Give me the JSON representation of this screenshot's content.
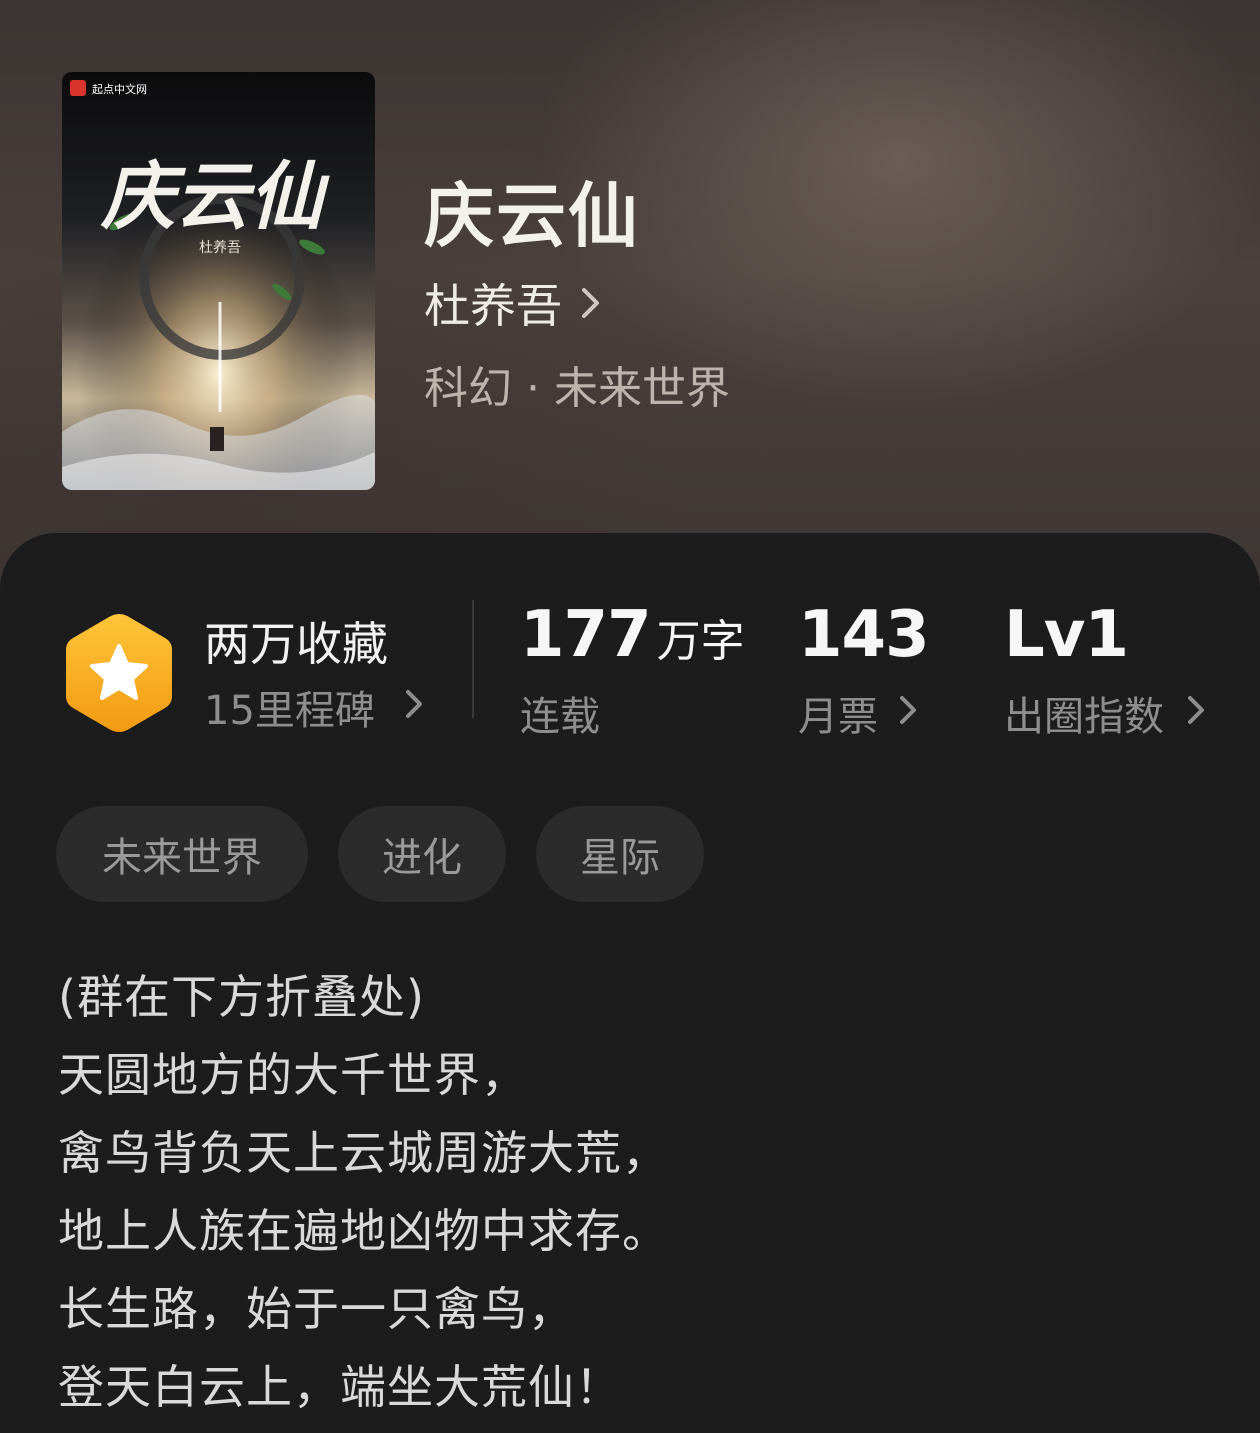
{
  "book": {
    "title": "庆云仙",
    "author": "杜养吾",
    "genre": "科幻 · 未来世界",
    "cover": {
      "publisher_logo_text": "起点中文网",
      "title_art": "庆云仙",
      "author_art": "杜养吾"
    }
  },
  "stats": {
    "favorites": {
      "main": "两万收藏",
      "sub": "15里程碑"
    },
    "word_count": {
      "value": "177",
      "unit": "万字",
      "label": "连载"
    },
    "monthly_tickets": {
      "value": "143",
      "label": "月票"
    },
    "popularity": {
      "value": "Lv1",
      "label": "出圈指数"
    }
  },
  "tags": [
    "未来世界",
    "进化",
    "星际"
  ],
  "description": [
    "(群在下方折叠处)",
    "天圆地方的大千世界，",
    "禽鸟背负天上云城周游大荒，",
    "地上人族在遍地凶物中求存。",
    "长生路，始于一只禽鸟，",
    "登天白云上，端坐大荒仙！"
  ],
  "colors": {
    "background": "#1c1c1c",
    "hero_top": "#3b3432",
    "badge_orange": "#f5a623",
    "tag_bg": "#2b2b2b",
    "muted_text": "#8e8e8e"
  },
  "icons": {
    "badge": "star-hexagon-icon",
    "chevron": "chevron-right-icon"
  }
}
